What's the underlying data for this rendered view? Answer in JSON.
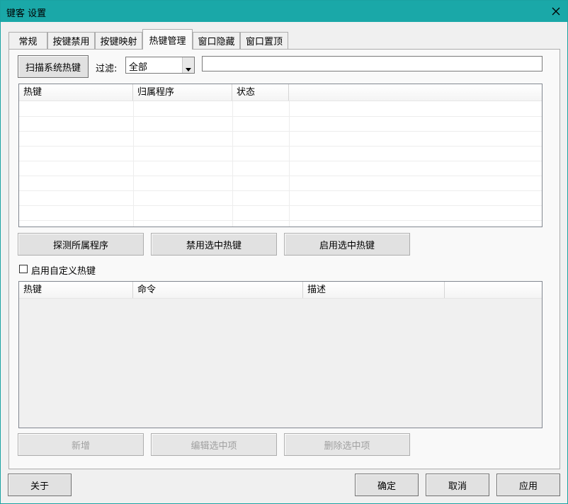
{
  "window": {
    "title": "键客 设置"
  },
  "tabs": [
    {
      "label": "常规",
      "active": false
    },
    {
      "label": "按键禁用",
      "active": false
    },
    {
      "label": "按键映射",
      "active": false
    },
    {
      "label": "热键管理",
      "active": true
    },
    {
      "label": "窗口隐藏",
      "active": false
    },
    {
      "label": "窗口置顶",
      "active": false
    }
  ],
  "scan": {
    "button_label": "扫描系统热键"
  },
  "filter": {
    "label": "过滤:",
    "selected": "全部",
    "search_value": ""
  },
  "hotkey_list": {
    "columns": [
      "热键",
      "归属程序",
      "状态",
      ""
    ],
    "rows": []
  },
  "hotkey_actions": {
    "detect_label": "探测所属程序",
    "disable_label": "禁用选中热键",
    "enable_label": "启用选中热键"
  },
  "custom": {
    "checkbox_label": "启用自定义热键",
    "checked": false,
    "columns": [
      "热键",
      "命令",
      "描述",
      ""
    ],
    "rows": [],
    "add_label": "新增",
    "edit_label": "编辑选中项",
    "delete_label": "删除选中项"
  },
  "footer": {
    "about_label": "关于",
    "ok_label": "确定",
    "cancel_label": "取消",
    "apply_label": "应用"
  }
}
